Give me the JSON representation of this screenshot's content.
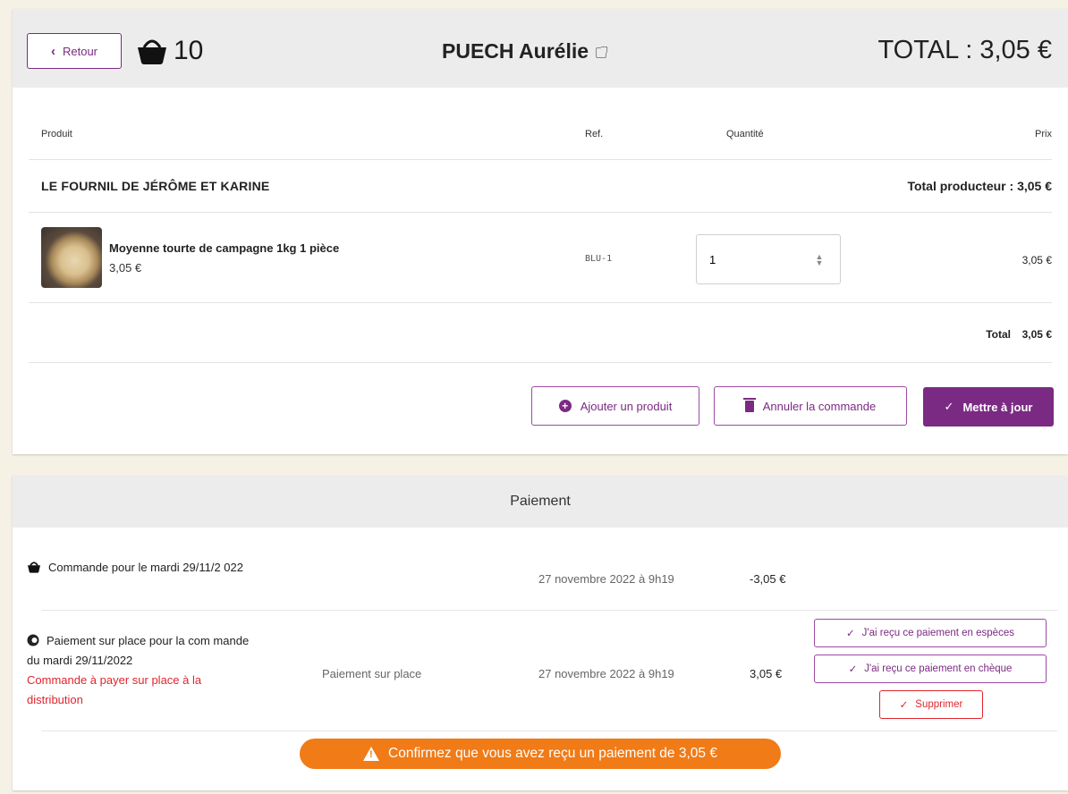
{
  "header": {
    "back_label": "Retour",
    "basket_count": "10",
    "customer_name": "PUECH Aurélie",
    "total": "TOTAL : 3,05 €"
  },
  "table": {
    "columns": {
      "product": "Produit",
      "ref": "Ref.",
      "quantity": "Quantité",
      "price": "Prix"
    },
    "producer": {
      "name": "LE FOURNIL DE JÉRÔME ET KARINE",
      "total": "Total producteur : 3,05 €"
    },
    "product": {
      "name": "Moyenne tourte de campagne 1kg 1 pièce",
      "unit_price": "3,05 €",
      "ref": "BLU-1",
      "quantity": "1",
      "price": "3,05 €"
    },
    "total_label": "Total",
    "total_value": "3,05 €"
  },
  "actions": {
    "add_product": "Ajouter un produit",
    "cancel_order": "Annuler la commande",
    "update": "Mettre à jour"
  },
  "payment": {
    "title": "Paiement",
    "row1": {
      "description": "Commande pour le mardi 29/11/2 022",
      "date": "27 novembre 2022 à 9h19",
      "amount": "-3,05 €"
    },
    "row2": {
      "description": "Paiement sur place pour la com mande du mardi 29/11/2022",
      "warning": "Commande à payer sur place à la distribution",
      "method": "Paiement sur place",
      "date": "27 novembre 2022 à 9h19",
      "amount": "3,05 €",
      "btn_cash": "J'ai reçu ce paiement en espèces",
      "btn_cheque": "J'ai reçu ce paiement en chèque",
      "btn_delete": "Supprimer"
    },
    "alert": "Confirmez que vous avez reçu un paiement de 3,05 €"
  }
}
